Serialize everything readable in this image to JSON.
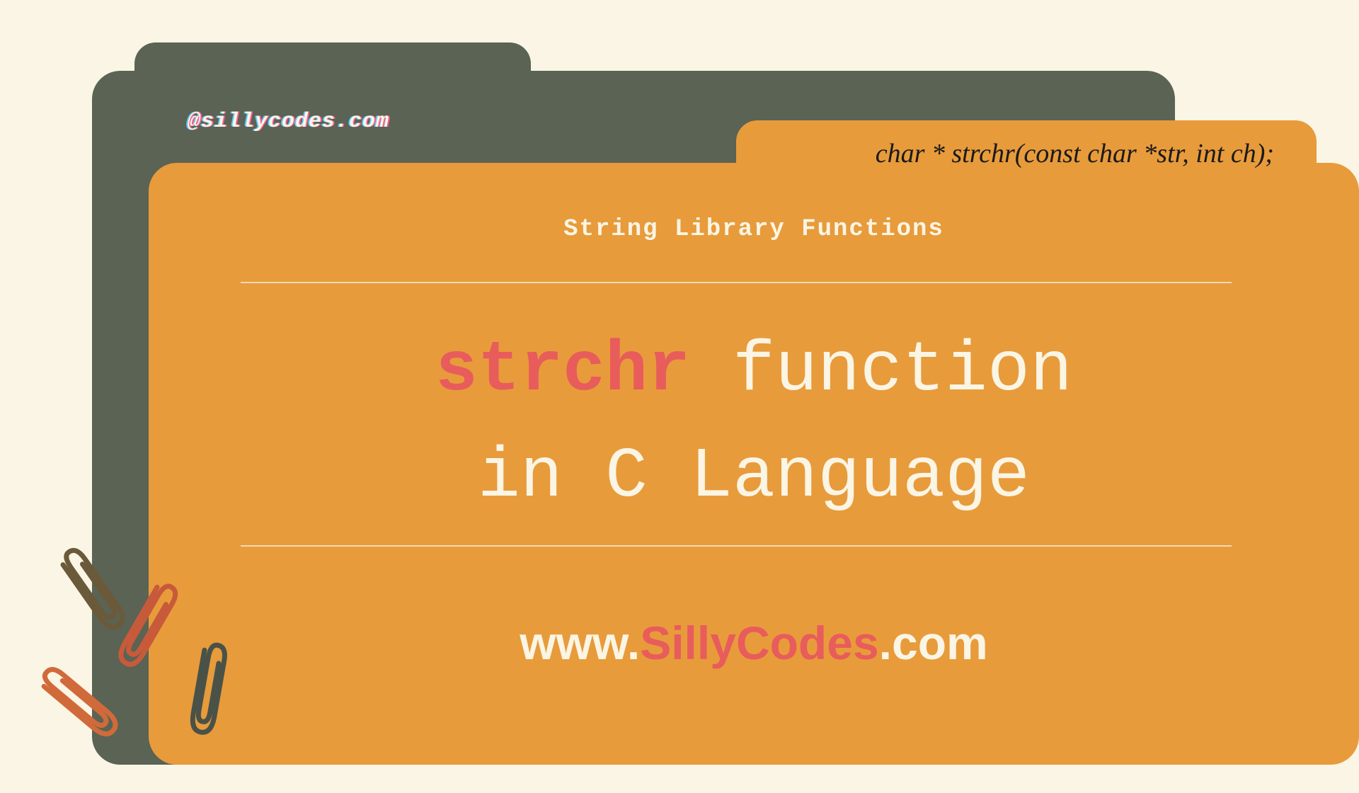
{
  "handle": "@sillycodes.com",
  "signature": "char * strchr(const char *str, int ch);",
  "subtitle": "String Library Functions",
  "title": {
    "accent": "strchr",
    "line1_rest": " function",
    "line2": "in C Language"
  },
  "url": {
    "prefix": "www.",
    "domain": "SillyCodes",
    "suffix": ".com"
  },
  "colors": {
    "background": "#faf5e4",
    "folder_back": "#5a6354",
    "folder_front": "#e89b3b",
    "accent": "#e85c5c",
    "text_light": "#faf5e4"
  }
}
